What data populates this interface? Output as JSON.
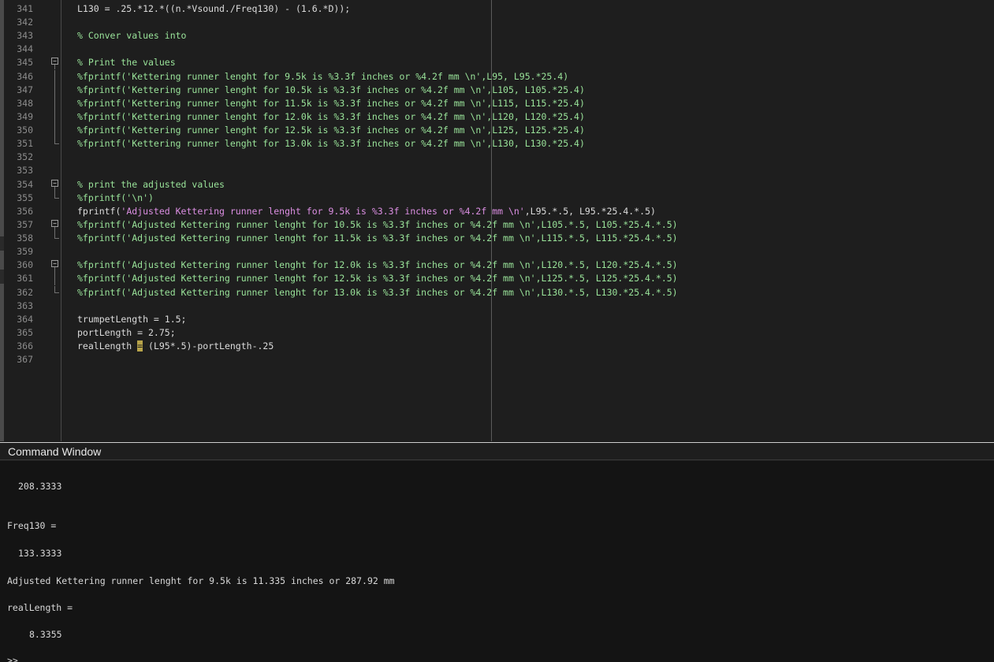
{
  "editor": {
    "lines": [
      {
        "num": "341",
        "type": "plain",
        "text": "L130 = .25.*12.*((n.*Vsound./Freq130) - (1.6.*D));",
        "fold": ""
      },
      {
        "num": "342",
        "type": "plain",
        "text": "",
        "fold": ""
      },
      {
        "num": "343",
        "type": "comment",
        "text": "% Conver values into",
        "fold": ""
      },
      {
        "num": "344",
        "type": "plain",
        "text": "",
        "fold": ""
      },
      {
        "num": "345",
        "type": "comment",
        "text": "% Print the values",
        "fold": "start"
      },
      {
        "num": "346",
        "type": "comment",
        "text": "%fprintf('Kettering runner lenght for 9.5k is %3.3f inches or %4.2f mm \\n',L95, L95.*25.4)",
        "fold": "mid"
      },
      {
        "num": "347",
        "type": "comment",
        "text": "%fprintf('Kettering runner lenght for 10.5k is %3.3f inches or %4.2f mm \\n',L105, L105.*25.4)",
        "fold": "mid"
      },
      {
        "num": "348",
        "type": "comment",
        "text": "%fprintf('Kettering runner lenght for 11.5k is %3.3f inches or %4.2f mm \\n',L115, L115.*25.4)",
        "fold": "mid"
      },
      {
        "num": "349",
        "type": "comment",
        "text": "%fprintf('Kettering runner lenght for 12.0k is %3.3f inches or %4.2f mm \\n',L120, L120.*25.4)",
        "fold": "mid"
      },
      {
        "num": "350",
        "type": "comment",
        "text": "%fprintf('Kettering runner lenght for 12.5k is %3.3f inches or %4.2f mm \\n',L125, L125.*25.4)",
        "fold": "mid"
      },
      {
        "num": "351",
        "type": "comment",
        "text": "%fprintf('Kettering runner lenght for 13.0k is %3.3f inches or %4.2f mm \\n',L130, L130.*25.4)",
        "fold": "end"
      },
      {
        "num": "352",
        "type": "plain",
        "text": "",
        "fold": ""
      },
      {
        "num": "353",
        "type": "plain",
        "text": "",
        "fold": ""
      },
      {
        "num": "354",
        "type": "comment",
        "text": "% print the adjusted values",
        "fold": "start"
      },
      {
        "num": "355",
        "type": "comment",
        "text": "%fprintf('\\n')",
        "fold": "end"
      },
      {
        "num": "356",
        "type": "fprintf",
        "pre": "fprintf(",
        "str": "'Adjusted Kettering runner lenght for 9.5k is %3.3f inches or %4.2f mm \\n'",
        "post": ",L95.*.5, L95.*25.4.*.5)",
        "fold": ""
      },
      {
        "num": "357",
        "type": "comment",
        "text": "%fprintf('Adjusted Kettering runner lenght for 10.5k is %3.3f inches or %4.2f mm \\n',L105.*.5, L105.*25.4.*.5)",
        "fold": "start"
      },
      {
        "num": "358",
        "type": "comment",
        "text": "%fprintf('Adjusted Kettering runner lenght for 11.5k is %3.3f inches or %4.2f mm \\n',L115.*.5, L115.*25.4.*.5)",
        "fold": "end"
      },
      {
        "num": "359",
        "type": "plain",
        "text": "",
        "fold": ""
      },
      {
        "num": "360",
        "type": "comment",
        "text": "%fprintf('Adjusted Kettering runner lenght for 12.0k is %3.3f inches or %4.2f mm \\n',L120.*.5, L120.*25.4.*.5)",
        "fold": "start"
      },
      {
        "num": "361",
        "type": "comment",
        "text": "%fprintf('Adjusted Kettering runner lenght for 12.5k is %3.3f inches or %4.2f mm \\n',L125.*.5, L125.*25.4.*.5)",
        "fold": "mid"
      },
      {
        "num": "362",
        "type": "comment",
        "text": "%fprintf('Adjusted Kettering runner lenght for 13.0k is %3.3f inches or %4.2f mm \\n',L130.*.5, L130.*25.4.*.5)",
        "fold": "end"
      },
      {
        "num": "363",
        "type": "plain",
        "text": "",
        "fold": ""
      },
      {
        "num": "364",
        "type": "plain",
        "text": "trumpetLength = 1.5;",
        "fold": ""
      },
      {
        "num": "365",
        "type": "plain",
        "text": "portLength = 2.75;",
        "fold": ""
      },
      {
        "num": "366",
        "type": "cursor",
        "pre": "realLength ",
        "mark": "=",
        "post": " (L95*.5)-portLength-.25",
        "fold": ""
      },
      {
        "num": "367",
        "type": "plain",
        "text": "",
        "fold": ""
      }
    ]
  },
  "command_window": {
    "title": "Command Window",
    "output": [
      {
        "text": "208.3333",
        "indent": "value"
      },
      {
        "text": "Freq130 =",
        "indent": "none"
      },
      {
        "text": "133.3333",
        "indent": "value"
      },
      {
        "text": "Adjusted Kettering runner lenght for 9.5k is 11.335 inches or 287.92 mm",
        "indent": "none"
      },
      {
        "text": "realLength =",
        "indent": "none"
      },
      {
        "text": "8.3355",
        "indent": "value2"
      },
      {
        "text": ">>",
        "indent": "none"
      }
    ]
  }
}
